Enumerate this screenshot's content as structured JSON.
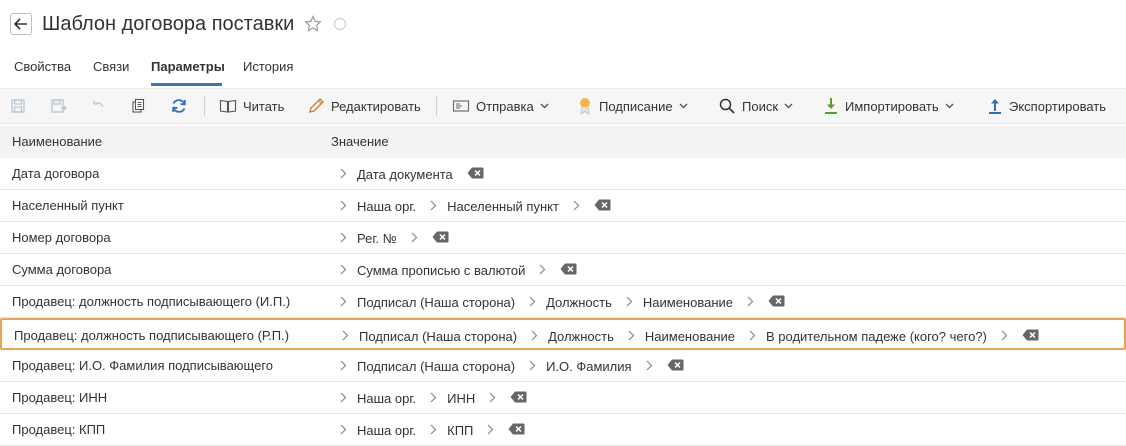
{
  "header": {
    "title": "Шаблон договора поставки"
  },
  "tabs": [
    {
      "label": "Свойства"
    },
    {
      "label": "Связи"
    },
    {
      "label": "Параметры"
    },
    {
      "label": "История"
    }
  ],
  "toolbar": {
    "read": "Читать",
    "edit": "Редактировать",
    "send": "Отправка",
    "sign": "Подписание",
    "search": "Поиск",
    "import": "Импортировать",
    "export": "Экспортировать"
  },
  "table": {
    "columns": [
      "Наименование",
      "Значение"
    ],
    "rows": [
      {
        "name": "Дата договора",
        "path": [
          "Дата документа"
        ]
      },
      {
        "name": "Населенный пункт",
        "path": [
          "Наша орг.",
          "Населенный пункт"
        ]
      },
      {
        "name": "Номер договора",
        "path": [
          "Рег. №"
        ]
      },
      {
        "name": "Сумма договора",
        "path": [
          "Сумма прописью с валютой"
        ]
      },
      {
        "name": "Продавец: должность подписывающего (И.П.)",
        "path": [
          "Подписал (Наша сторона)",
          "Должность",
          "Наименование"
        ]
      },
      {
        "name": "Продавец: должность подписывающего (Р.П.)",
        "path": [
          "Подписал (Наша сторона)",
          "Должность",
          "Наименование",
          "В родительном падеже (кого? чего?)"
        ]
      },
      {
        "name": "Продавец: И.О. Фамилия подписывающего",
        "path": [
          "Подписал (Наша сторона)",
          "И.О. Фамилия"
        ]
      },
      {
        "name": "Продавец: ИНН",
        "path": [
          "Наша орг.",
          "ИНН"
        ]
      },
      {
        "name": "Продавец: КПП",
        "path": [
          "Наша орг.",
          "КПП"
        ]
      }
    ]
  }
}
